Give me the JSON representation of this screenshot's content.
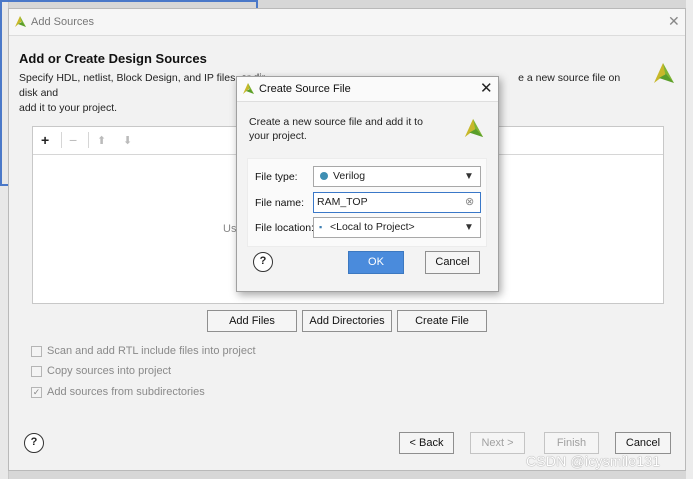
{
  "main_dialog": {
    "title": "Add Sources",
    "heading": "Add or Create Design Sources",
    "description_line1": "Specify HDL, netlist, Block Design, and IP files, or dir",
    "description_line1_tail": "e a new source file on disk and",
    "description_line2": "add it to your project.",
    "panel_hint": "Us",
    "buttons": {
      "add_files": "Add Files",
      "add_directories": "Add Directories",
      "create_file": "Create File",
      "back": "< Back",
      "next": "Next >",
      "finish": "Finish",
      "cancel": "Cancel"
    },
    "options": [
      {
        "label": "Scan and add RTL include files into project",
        "checked": false
      },
      {
        "label": "Copy sources into project",
        "checked": false
      },
      {
        "label": "Add sources from subdirectories",
        "checked": true
      }
    ]
  },
  "modal": {
    "title": "Create Source File",
    "description": "Create a new source file and add it to your project.",
    "file_type_label": "File type:",
    "file_type_value": "Verilog",
    "file_name_label": "File name:",
    "file_name_value": "RAM_TOP",
    "file_location_label": "File location:",
    "file_location_value": "<Local to Project>",
    "ok_label": "OK",
    "cancel_label": "Cancel"
  },
  "watermark": "CSDN @icysmile131",
  "colors": {
    "accent": "#4a8bdc",
    "logo_yellow": "#c8b82a",
    "logo_green": "#7fb534",
    "verilog_dot": "#3f8fb3"
  }
}
